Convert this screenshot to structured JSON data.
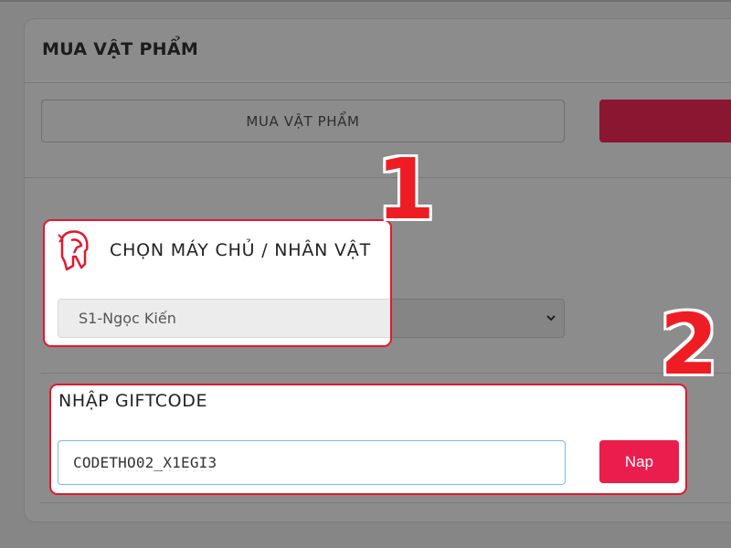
{
  "panel": {
    "title": "MUA VẬT PHẨM",
    "tab_buy_label": "MUA VẬT PHẨM"
  },
  "server_section": {
    "title": "CHỌN MÁY CHỦ / NHÂN VẬT",
    "icon": "spartan-helmet-icon",
    "selected_value": "S1-Ngọc Kiến"
  },
  "giftcode_section": {
    "title": "NHẬP GIFTCODE",
    "input_value": "CODETHO02_X1EGI3",
    "submit_label": "Nap"
  },
  "annotations": {
    "step1": "1",
    "step2": "2",
    "highlight_color": "#e1182e"
  },
  "colors": {
    "accent_red": "#ea1d4d",
    "tab_red": "#8b1631"
  }
}
